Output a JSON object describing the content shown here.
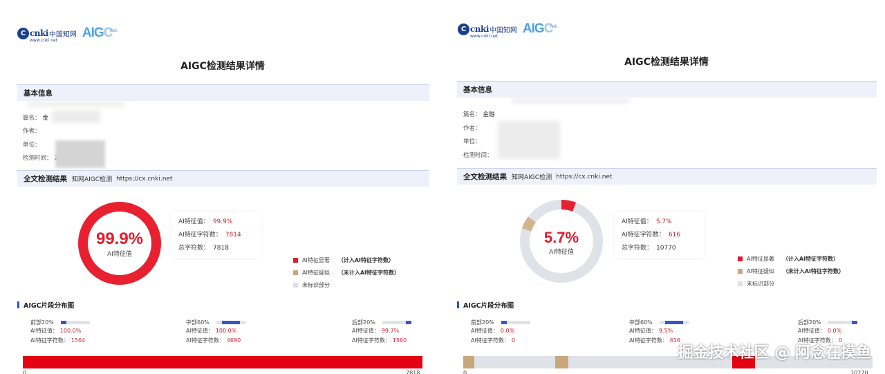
{
  "left": {
    "logo": {
      "cnki_letters": "cnki",
      "cnki_cn": "中国知网",
      "cnki_url": "www.cnki.net",
      "aigc": "AIG",
      "aigc_o": "C",
      "check": "heck"
    },
    "title": "AIGC检测结果详情",
    "basic_info": {
      "section_title": "基本信息",
      "fields": [
        {
          "label": "篇名：",
          "value": "金"
        },
        {
          "label": "作者：",
          "value": ""
        },
        {
          "label": "单位：",
          "value": ""
        },
        {
          "label": "检测时间：",
          "value": "2025"
        }
      ]
    },
    "result": {
      "section_title": "全文检测结果",
      "subtitle": "知网AIGC检测",
      "url": "https://cx.cnki.net",
      "percent_text": "99.9%",
      "percent_label": "AI特征值",
      "stats": [
        {
          "label": "AI特征值：",
          "value": "99.9%"
        },
        {
          "label": "AI特征字符数：",
          "value": "7814"
        },
        {
          "label": "总字符数：",
          "value": "7818"
        }
      ],
      "legend": [
        {
          "label": "AI特征显著",
          "note": "（计入AI特征字符数）",
          "color": "#e31b2b"
        },
        {
          "label": "AI特征疑似",
          "note": "（未计入AI特征字符数）",
          "color": "#c9a77c"
        },
        {
          "label": "未标识部分",
          "note": "",
          "color": "#dde1e6"
        }
      ],
      "donut": {
        "significant": 0.999,
        "suspected": 0.0
      }
    },
    "distribution": {
      "title": "AIGC片段分布图",
      "segments": [
        {
          "name": "前部20%",
          "ai_label": "AI特征值：",
          "ai_value": "100.0%",
          "chars_label": "AI特征字符数：",
          "chars_value": "1564",
          "bar_fraction": 0.2,
          "bar_offset": 0.0
        },
        {
          "name": "中部60%",
          "ai_label": "AI特征值：",
          "ai_value": "100.0%",
          "chars_label": "AI特征字符数：",
          "chars_value": "4690",
          "bar_fraction": 0.6,
          "bar_offset": 0.2
        },
        {
          "name": "后部20%",
          "ai_label": "AI特征值：",
          "ai_value": "99.7%",
          "chars_label": "AI特征字符数：",
          "chars_value": "1560",
          "bar_fraction": 0.2,
          "bar_offset": 0.8
        }
      ],
      "axis_start": "0",
      "axis_end": "7818"
    }
  },
  "right": {
    "logo": {
      "cnki_letters": "cnki",
      "cnki_cn": "中国知网",
      "cnki_url": "www.cnki.net",
      "aigc": "AIG",
      "aigc_o": "C",
      "check": "heck"
    },
    "title": "AIGC检测结果详情",
    "basic_info": {
      "section_title": "基本信息",
      "fields": [
        {
          "label": "篇名：",
          "value": "金融"
        },
        {
          "label": "作者：",
          "value": ""
        },
        {
          "label": "单位：",
          "value": ""
        },
        {
          "label": "检测时间：",
          "value": ""
        }
      ]
    },
    "result": {
      "section_title": "全文检测结果",
      "subtitle": "知网AIGC检测",
      "url": "https://cx.cnki.net",
      "percent_text": "5.7%",
      "percent_label": "AI特征值",
      "stats": [
        {
          "label": "AI特征值：",
          "value": "5.7%"
        },
        {
          "label": "AI特征字符数：",
          "value": "616"
        },
        {
          "label": "总字符数：",
          "value": "10770"
        }
      ],
      "legend": [
        {
          "label": "AI特征显著",
          "note": "（计入AI特征字符数）",
          "color": "#e31b2b"
        },
        {
          "label": "AI特征疑似",
          "note": "（未计入AI特征字符数）",
          "color": "#c9a77c"
        },
        {
          "label": "未标识部分",
          "note": "",
          "color": "#dde1e6"
        }
      ],
      "donut": {
        "significant": 0.057,
        "suspected": 0.05
      }
    },
    "distribution": {
      "title": "AIGC片段分布图",
      "segments": [
        {
          "name": "前部20%",
          "ai_label": "AI特征值：",
          "ai_value": "0.0%",
          "chars_label": "AI特征字符数：",
          "chars_value": "0",
          "bar_fraction": 0.2,
          "bar_offset": 0.0
        },
        {
          "name": "中部60%",
          "ai_label": "AI特征值：",
          "ai_value": "9.5%",
          "chars_label": "AI特征字符数：",
          "chars_value": "616",
          "bar_fraction": 0.6,
          "bar_offset": 0.2
        },
        {
          "name": "后部20%",
          "ai_label": "AI特征值：",
          "ai_value": "0.0%",
          "chars_label": "AI特征字符数：",
          "chars_value": "0",
          "bar_fraction": 0.2,
          "bar_offset": 0.8
        }
      ],
      "axis_start": "0",
      "axis_end": "10770"
    }
  },
  "watermark": "掘金技术社区 @ 阿念在摸鱼"
}
